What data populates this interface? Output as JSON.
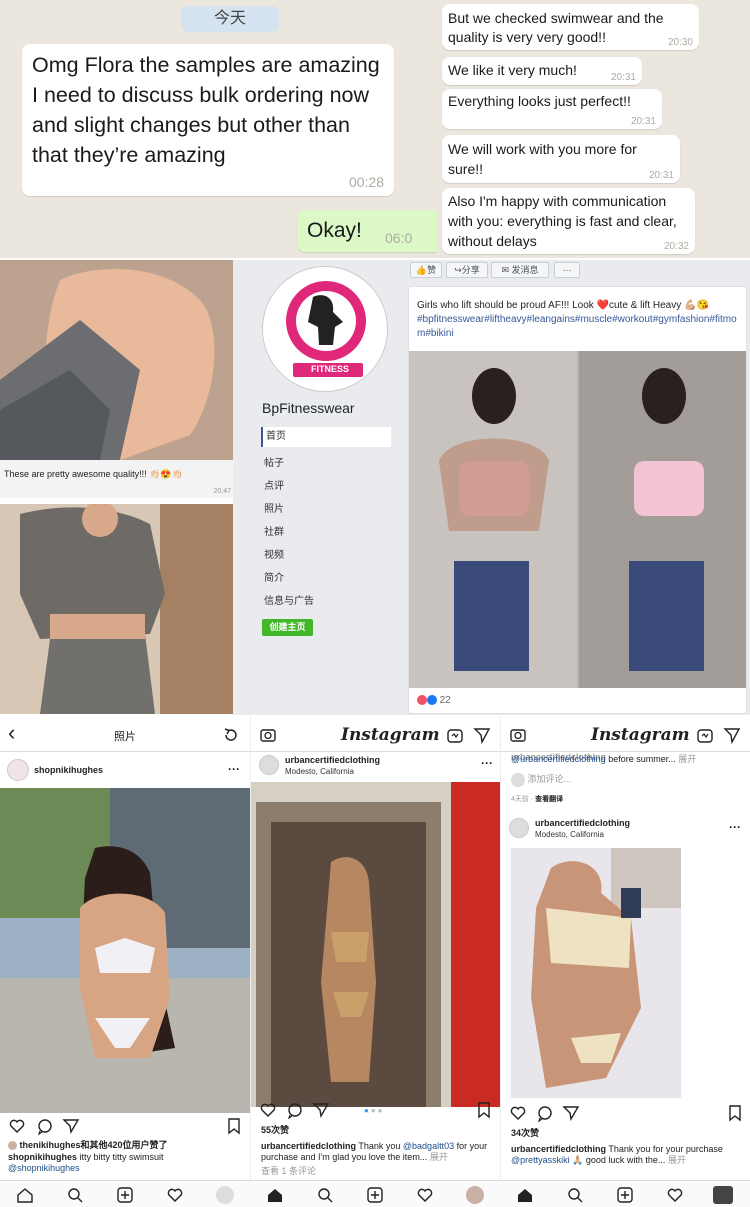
{
  "chat_left": {
    "date_label": "今天",
    "message": "Omg Flora the samples are amazing I need to discuss bulk ordering now and slight changes but other than that they’re amazing",
    "message_time": "00:28",
    "reply": "Okay!",
    "reply_time": "06:0"
  },
  "chat_right": {
    "messages": [
      {
        "text": "But we checked swimwear and the quality is very very good!!",
        "time": "20:30"
      },
      {
        "text": "We like it very much!",
        "time": "20:31"
      },
      {
        "text": "Everything looks just perfect!!",
        "time": "20:31"
      },
      {
        "text": "We will work with you more for sure!!",
        "time": "20:31"
      },
      {
        "text": "Also I'm happy with communication with you: everything is fast and clear, without delays",
        "time": "20:32"
      }
    ]
  },
  "glove_chat": {
    "caption": "These are pretty awesome quality!!! 👏🏻😍👏🏻",
    "time": "20:47"
  },
  "facebook": {
    "logo_text": "FITNESS",
    "page_name": "BpFitnesswear",
    "nav": [
      "首页",
      "帖子",
      "点评",
      "照片",
      "社群",
      "视频",
      "简介",
      "信息与广告"
    ],
    "create_button": "创建主页",
    "actions": {
      "like": "赞",
      "share": "分享",
      "message": "发消息",
      "more": "···"
    },
    "post_text": "Girls who lift should be proud AF!!! Look ❤️cute & lift Heavy 💪🏼😘",
    "post_tags": "#bpfitnesswear#liftheavy#leangains#muscle#workout#gymfashion#fitmom#bikini",
    "reactions_count": "22"
  },
  "ig_panel1": {
    "back": "‹",
    "title": "照片",
    "username": "shopnikihughes",
    "liked_by": "thenikihughes和其他420位用户赞了",
    "caption_user": "shopnikihughes",
    "caption_text": "itty bitty titty swimsuit",
    "mention": "@shopnikihughes"
  },
  "ig_panel2": {
    "logo": "Instagram",
    "username": "urbancertifiedclothing",
    "location": "Modesto, California",
    "likes": "55次赞",
    "caption_user": "urbancertifiedclothing",
    "caption_part1": "Thank you",
    "mention": "@badgaltt03",
    "caption_part2": "for your purchase and I'm glad you love the item...",
    "more": "展开",
    "comments": "查看 1 条评论"
  },
  "ig_panel3": {
    "logo": "Instagram",
    "prev_caption_user": "urbancertifiedclothing",
    "prev_mention": "@urbancertifiedclothing",
    "prev_caption": "before summer...",
    "prev_more": "展开",
    "add_comment": "添加评论...",
    "prev_time": "4天前",
    "translate": "查看翻译",
    "username": "urbancertifiedclothing",
    "location": "Modesto, California",
    "likes": "34次赞",
    "caption_user": "urbancertifiedclothing",
    "caption_text": "Thank you for your purchase",
    "mention": "@prettyasskiki",
    "caption_part2": "🙏🏼 good luck with the...",
    "more": "展开"
  },
  "colors": {
    "chat_bg": "#ebe7df",
    "bubble_green": "#dcf8c6",
    "fb_blue": "#3b5998",
    "fb_green_button": "#42b72a",
    "brand_pink": "#e0287a",
    "ig_link": "#1f4e8a"
  },
  "icons": [
    "back-icon",
    "refresh-icon",
    "camera-icon",
    "igtv-icon",
    "direct-icon",
    "heart-icon",
    "comment-icon",
    "share-icon",
    "bookmark-icon",
    "home-icon",
    "search-icon",
    "add-icon",
    "activity-icon",
    "more-icon",
    "like-icon"
  ]
}
